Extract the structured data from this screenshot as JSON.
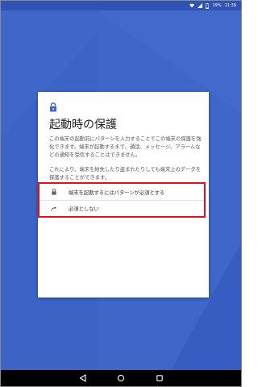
{
  "status_bar": {
    "battery_level": "19%",
    "time": "11:39",
    "icons": [
      "wifi-icon",
      "signal-icon",
      "battery-icon"
    ]
  },
  "dialog": {
    "icon": "lock-icon",
    "title": "起動時の保護",
    "paragraphs": [
      "この端末の起動前にパターンを入力することでこの端末の保護を強化できます。端末が起動するまで、通話、メッセージ、アラームなどの通知を受信することはできません。",
      "これにより、端末を紛失したり盗まれたりしても端末上のデータを保護することができます。"
    ],
    "options": [
      {
        "icon": "lock-icon",
        "label": "端末を起動するにはパターンが必須とする"
      },
      {
        "icon": "redirect-arrow-icon",
        "label": "必須としない"
      }
    ]
  },
  "nav_bar": {
    "buttons": [
      "back-icon",
      "home-icon",
      "recent-apps-icon"
    ]
  },
  "colors": {
    "background": "#3f67c9",
    "status_bar": "#2f54b3",
    "highlight_border": "#e0101e",
    "dialog_background": "#ffffff",
    "nav_bar": "#000000"
  }
}
